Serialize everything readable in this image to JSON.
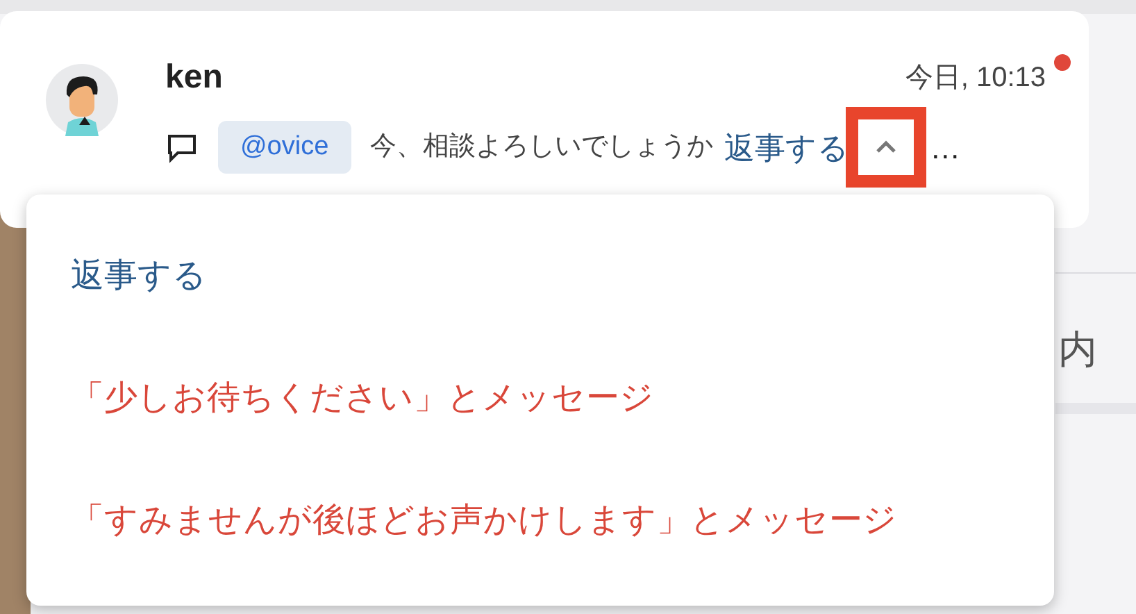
{
  "message": {
    "sender": "ken",
    "time": "今日, 10:13",
    "unread": true,
    "mention": "@ovice",
    "text": "今、相談よろしいでしょうか",
    "reply_link": "返事する",
    "trailing": "…",
    "expanded": true
  },
  "menu": {
    "items": [
      {
        "label": "返事する",
        "kind": "reply"
      },
      {
        "label": "「少しお待ちください」とメッセージ",
        "kind": "message"
      },
      {
        "label": "「すみませんが後ほどお声かけします」とメッセージ",
        "kind": "message"
      }
    ]
  },
  "background": {
    "text": "内"
  }
}
